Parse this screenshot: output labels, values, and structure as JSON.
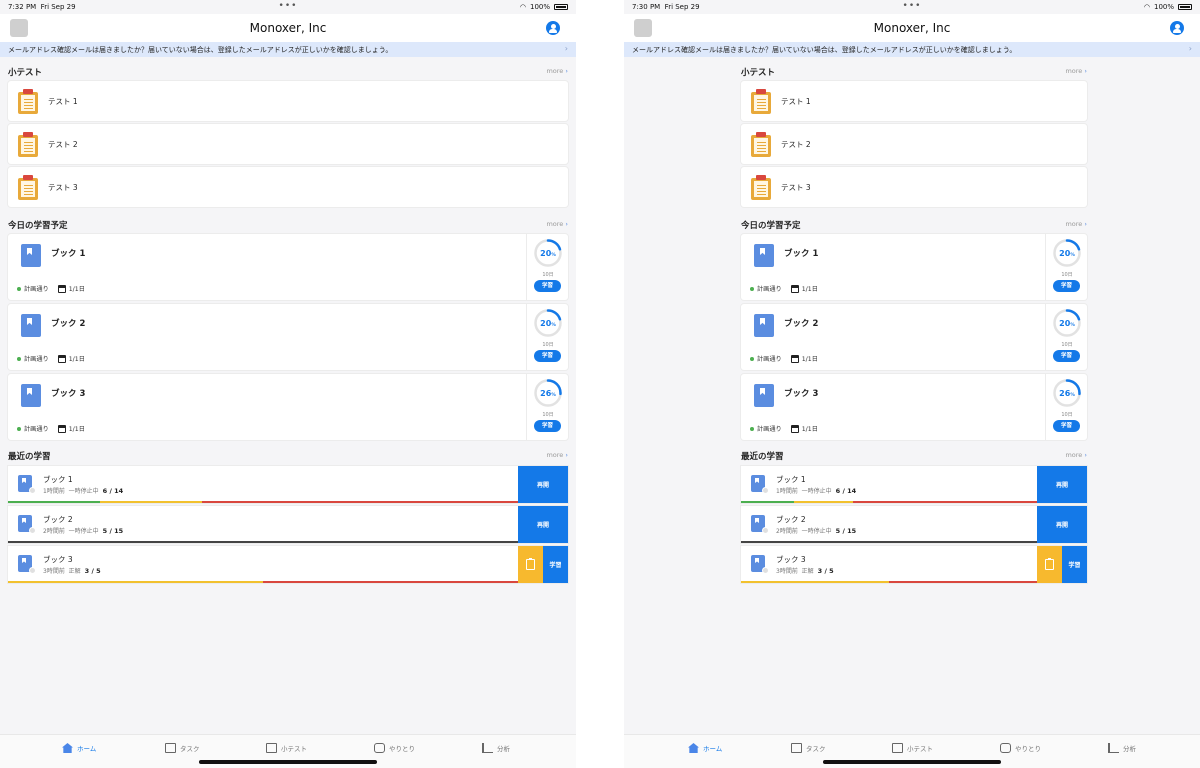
{
  "screens": [
    {
      "status_time": "7:32 PM",
      "status_date": "Fri Sep 29"
    },
    {
      "status_time": "7:30 PM",
      "status_date": "Fri Sep 29"
    }
  ],
  "status": {
    "dots": "•••",
    "battery": "100%"
  },
  "header": {
    "title": "Monoxer, Inc"
  },
  "banner": {
    "text": "メールアドレス確認メールは届きましたか？届いていない場合は、登録したメールアドレスが正しいかを確認しましょう。"
  },
  "more_label": "more",
  "quiz_section": {
    "title": "小テスト",
    "items": [
      {
        "label": "テスト 1"
      },
      {
        "label": "テスト 2"
      },
      {
        "label": "テスト 3"
      }
    ]
  },
  "schedule_section": {
    "title": "今日の学習予定",
    "plan_status": "計画通り",
    "items": [
      {
        "title": "ブック 1",
        "date": "1/1日",
        "percent": 20,
        "percent_text": "20",
        "day_label": "10日",
        "button": "学習"
      },
      {
        "title": "ブック 2",
        "date": "1/1日",
        "percent": 20,
        "percent_text": "20",
        "day_label": "10日",
        "button": "学習"
      },
      {
        "title": "ブック 3",
        "date": "1/1日",
        "percent": 26,
        "percent_text": "26",
        "day_label": "10日",
        "button": "学習"
      }
    ]
  },
  "percent_unit": "%",
  "recent_section": {
    "title": "最近の学習",
    "items": [
      {
        "title": "ブック 1",
        "time": "1時間前",
        "state": "一時停止中",
        "count": "6 / 14",
        "action": "再開",
        "progress": [
          0.18,
          0.2,
          0.62
        ]
      },
      {
        "title": "ブック 2",
        "time": "2時間前",
        "state": "一時停止中",
        "count": "5 / 15",
        "action": "再開",
        "progress": [
          0.0,
          0.0,
          1.0
        ]
      },
      {
        "title": "ブック 3",
        "time": "3時間前",
        "state": "正解",
        "count": "3 / 5",
        "action": "学習",
        "progress": [
          0.0,
          0.5,
          0.5
        ],
        "has_quiz": true
      }
    ]
  },
  "tabs": [
    {
      "label": "ホーム",
      "icon": "home-icon",
      "active": true
    },
    {
      "label": "タスク",
      "icon": "task-icon"
    },
    {
      "label": "小テスト",
      "icon": "quiz-icon"
    },
    {
      "label": "やりとり",
      "icon": "chat-icon"
    },
    {
      "label": "分析",
      "icon": "analytics-icon"
    }
  ],
  "colors": {
    "accent": "#1479e8",
    "progress_green": "#4caf50",
    "progress_yellow": "#f2c12e",
    "progress_red": "#d9473e",
    "quiz_yellow": "#f7b92e"
  }
}
